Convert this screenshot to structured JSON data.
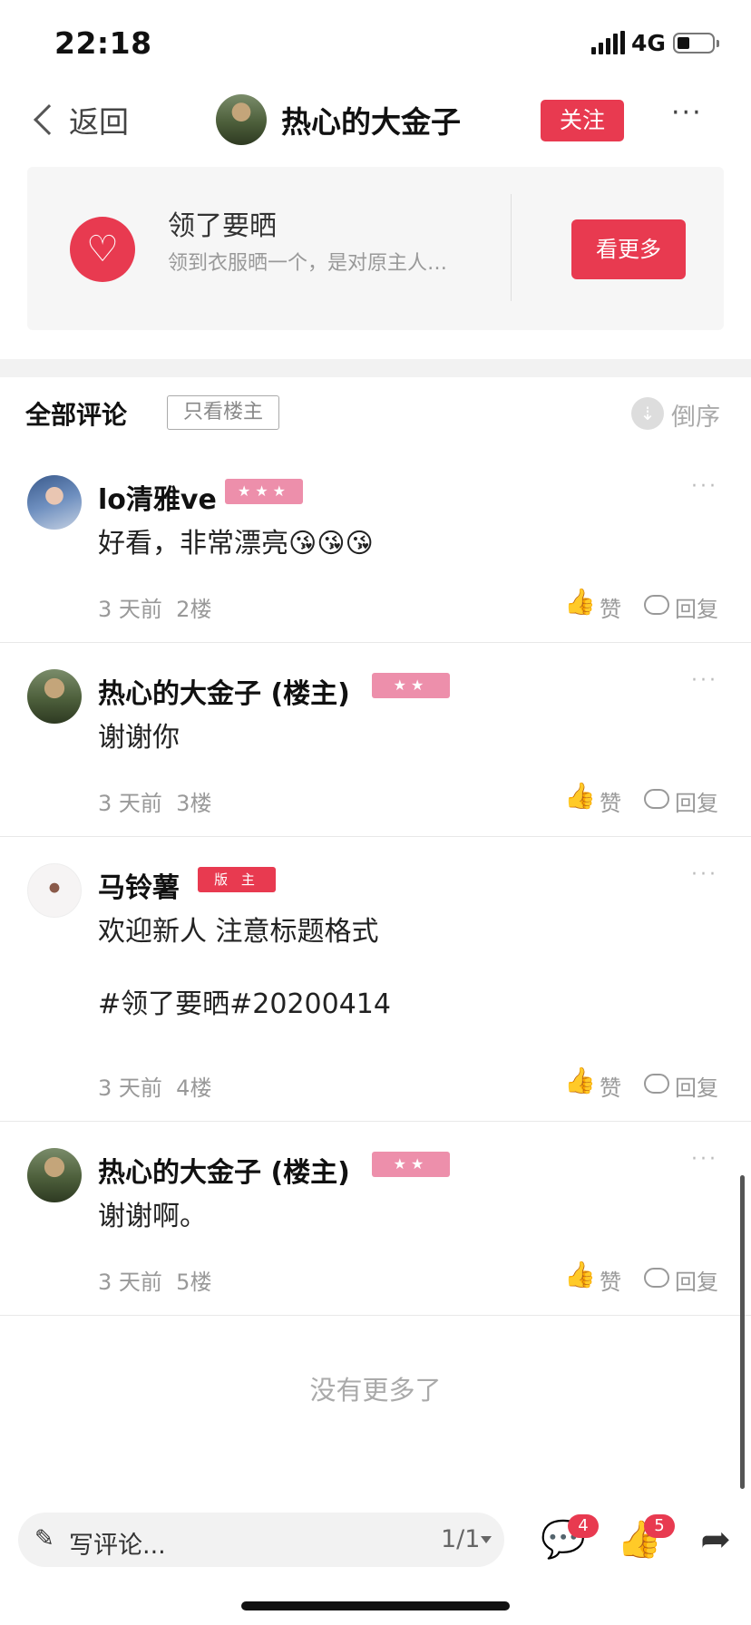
{
  "status_bar": {
    "time": "22:18",
    "network": "4G"
  },
  "nav": {
    "back_label": "返回",
    "title": "热心的大金子",
    "follow_label": "关注",
    "more": "···"
  },
  "topic_card": {
    "heart": "♡",
    "title": "领了要晒",
    "subtitle": "领到衣服晒一个，是对原主人…",
    "more_label": "看更多"
  },
  "comments_header": {
    "title": "全部评论",
    "filter_label": "只看楼主",
    "sort_icon": "⇣",
    "sort_label": "倒序"
  },
  "comments": [
    {
      "name": "lo清雅ve",
      "badge": "★★★",
      "text": "好看，非常漂亮😘😘😘",
      "time": "3 天前",
      "floor": "2楼",
      "like_label": "赞",
      "reply_label": "回复"
    },
    {
      "name": "热心的大金子 (楼主)",
      "badge": "★★",
      "text": "谢谢你",
      "time": "3 天前",
      "floor": "3楼",
      "like_label": "赞",
      "reply_label": "回复"
    },
    {
      "name": "马铃薯",
      "badge": "版 主",
      "text": "欢迎新人 注意标题格式\n\n#领了要晒#20200414",
      "time": "3 天前",
      "floor": "4楼",
      "like_label": "赞",
      "reply_label": "回复"
    },
    {
      "name": "热心的大金子 (楼主)",
      "badge": "★★",
      "text": "谢谢啊。",
      "time": "3 天前",
      "floor": "5楼",
      "like_label": "赞",
      "reply_label": "回复"
    }
  ],
  "no_more_text": "没有更多了",
  "bottom_bar": {
    "input_placeholder": "写评论...",
    "page_indicator": "1/1",
    "comment_count": "4",
    "like_count": "5",
    "icons": {
      "pencil": "✎",
      "comment": "💬",
      "like": "👍",
      "share": "➦"
    }
  },
  "colors": {
    "accent": "#e83a50",
    "badge_pink": "#ed8fab"
  }
}
